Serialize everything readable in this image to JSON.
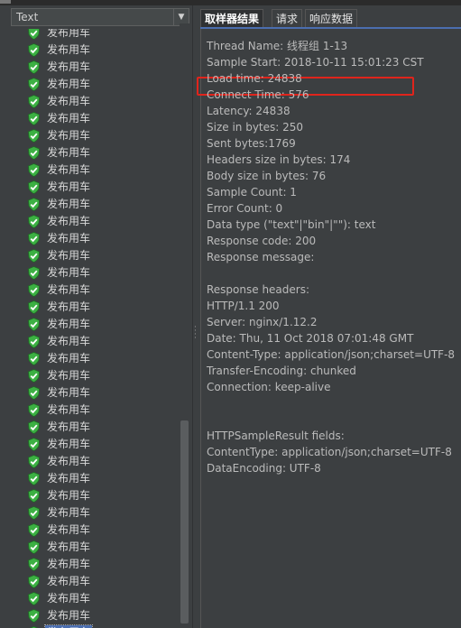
{
  "renderer": {
    "selected": "Text"
  },
  "tree": {
    "items": [
      "发布用车",
      "发布用车",
      "发布用车",
      "发布用车",
      "发布用车",
      "发布用车",
      "发布用车",
      "发布用车",
      "发布用车",
      "发布用车",
      "发布用车",
      "发布用车",
      "发布用车",
      "发布用车",
      "发布用车",
      "发布用车",
      "发布用车",
      "发布用车",
      "发布用车",
      "发布用车",
      "发布用车",
      "发布用车",
      "发布用车",
      "发布用车",
      "发布用车",
      "发布用车",
      "发布用车",
      "发布用车",
      "发布用车",
      "发布用车",
      "发布用车",
      "发布用车",
      "发布用车",
      "发布用车",
      "发布用车",
      "发布用车"
    ],
    "status_icon": "check-shield-icon",
    "status_color": "#3cb043",
    "selected_color": "#4b6eaf"
  },
  "tabs": [
    "取样器结果",
    "请求",
    "响应数据"
  ],
  "result": {
    "lines": [
      "Thread Name: 线程组 1-13",
      "Sample Start: 2018-10-11 15:01:23 CST",
      "Load time: 24838",
      "Connect Time: 576",
      "Latency: 24838",
      "Size in bytes: 250",
      "Sent bytes:1769",
      "Headers size in bytes: 174",
      "Body size in bytes: 76",
      "Sample Count: 1",
      "Error Count: 0",
      "Data type (\"text\"|\"bin\"|\"\"): text",
      "Response code: 200",
      "Response message: ",
      "",
      "Response headers:",
      "HTTP/1.1 200",
      "Server: nginx/1.12.2",
      "Date: Thu, 11 Oct 2018 07:01:48 GMT",
      "Content-Type: application/json;charset=UTF-8",
      "Transfer-Encoding: chunked",
      "Connection: keep-alive",
      "",
      "",
      "HTTPSampleResult fields:",
      "ContentType: application/json;charset=UTF-8",
      "DataEncoding: UTF-8"
    ],
    "highlight_color": "#e0241c"
  }
}
